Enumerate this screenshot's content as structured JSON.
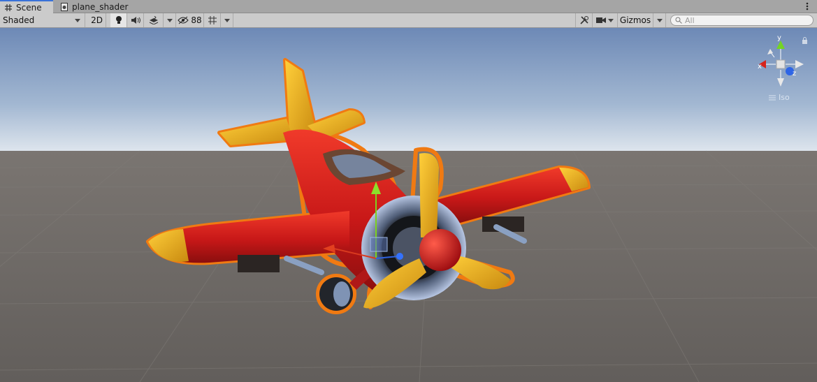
{
  "tabs": [
    {
      "label": "Scene",
      "icon": "grid-icon",
      "active": true
    },
    {
      "label": "plane_shader",
      "icon": "shader-file-icon",
      "active": false
    }
  ],
  "toolbar": {
    "draw_mode": "Shaded",
    "mode_2d": "2D",
    "hidden_count": "88",
    "gizmos_label": "Gizmos",
    "search_placeholder": "All"
  },
  "orientation_gizmo": {
    "x_label": "x",
    "y_label": "y",
    "z_label": "z",
    "projection_label": "Iso"
  },
  "colors": {
    "sky_top": "#6f8bb7",
    "horizon": "#c9d6e4",
    "ground": "#6a6663",
    "selection_outline": "#f07a12",
    "fuselage_red": "#d81f1f",
    "wing_tip_yellow": "#f2b21b",
    "accent_blue": "#3a72d8"
  }
}
